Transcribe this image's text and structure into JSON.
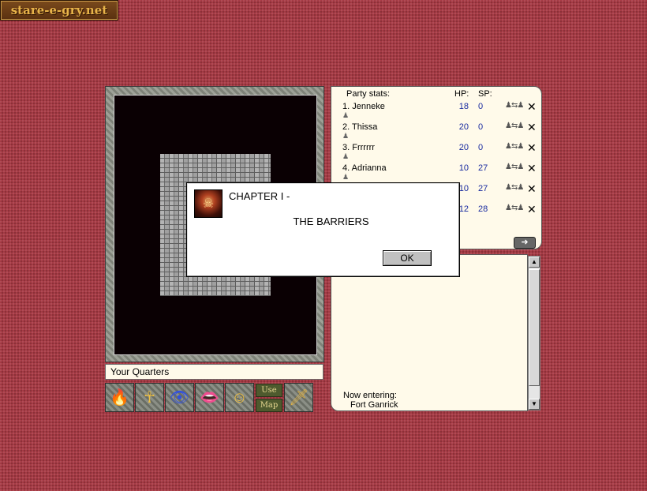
{
  "site": {
    "logo_text": "stare-e-gry.net"
  },
  "location": {
    "name": "Your Quarters"
  },
  "toolbar": {
    "buttons": [
      {
        "name": "spell-button",
        "icon": "fire-icon"
      },
      {
        "name": "ankh-button",
        "icon": "ankh-icon"
      },
      {
        "name": "eye-button",
        "icon": "eye-icon"
      },
      {
        "name": "talk-button",
        "icon": "mouth-icon"
      },
      {
        "name": "look-button",
        "icon": "face-icon"
      }
    ],
    "use_label": "Use",
    "map_label": "Map",
    "sword_icon": "sword-icon"
  },
  "party": {
    "title": "Party stats:",
    "hp_header": "HP:",
    "sp_header": "SP:",
    "members": [
      {
        "name": "1. Jenneke",
        "hp": "18",
        "sp": "0"
      },
      {
        "name": "2. Thissa",
        "hp": "20",
        "sp": "0"
      },
      {
        "name": "3. Frrrrrr",
        "hp": "20",
        "sp": "0"
      },
      {
        "name": "4. Adrianna",
        "hp": "10",
        "sp": "27"
      },
      {
        "name": "",
        "hp": "10",
        "sp": "27"
      },
      {
        "name": "",
        "hp": "12",
        "sp": "28"
      }
    ]
  },
  "log": {
    "line1": "Now entering:",
    "line2": "Fort Ganrick"
  },
  "dialog": {
    "title": "CHAPTER I -",
    "subtitle": "THE BARRIERS",
    "ok_label": "OK"
  },
  "colors": {
    "background": "#a63a44",
    "panel": "#fffaea",
    "stat_value": "#1a2ca0"
  }
}
